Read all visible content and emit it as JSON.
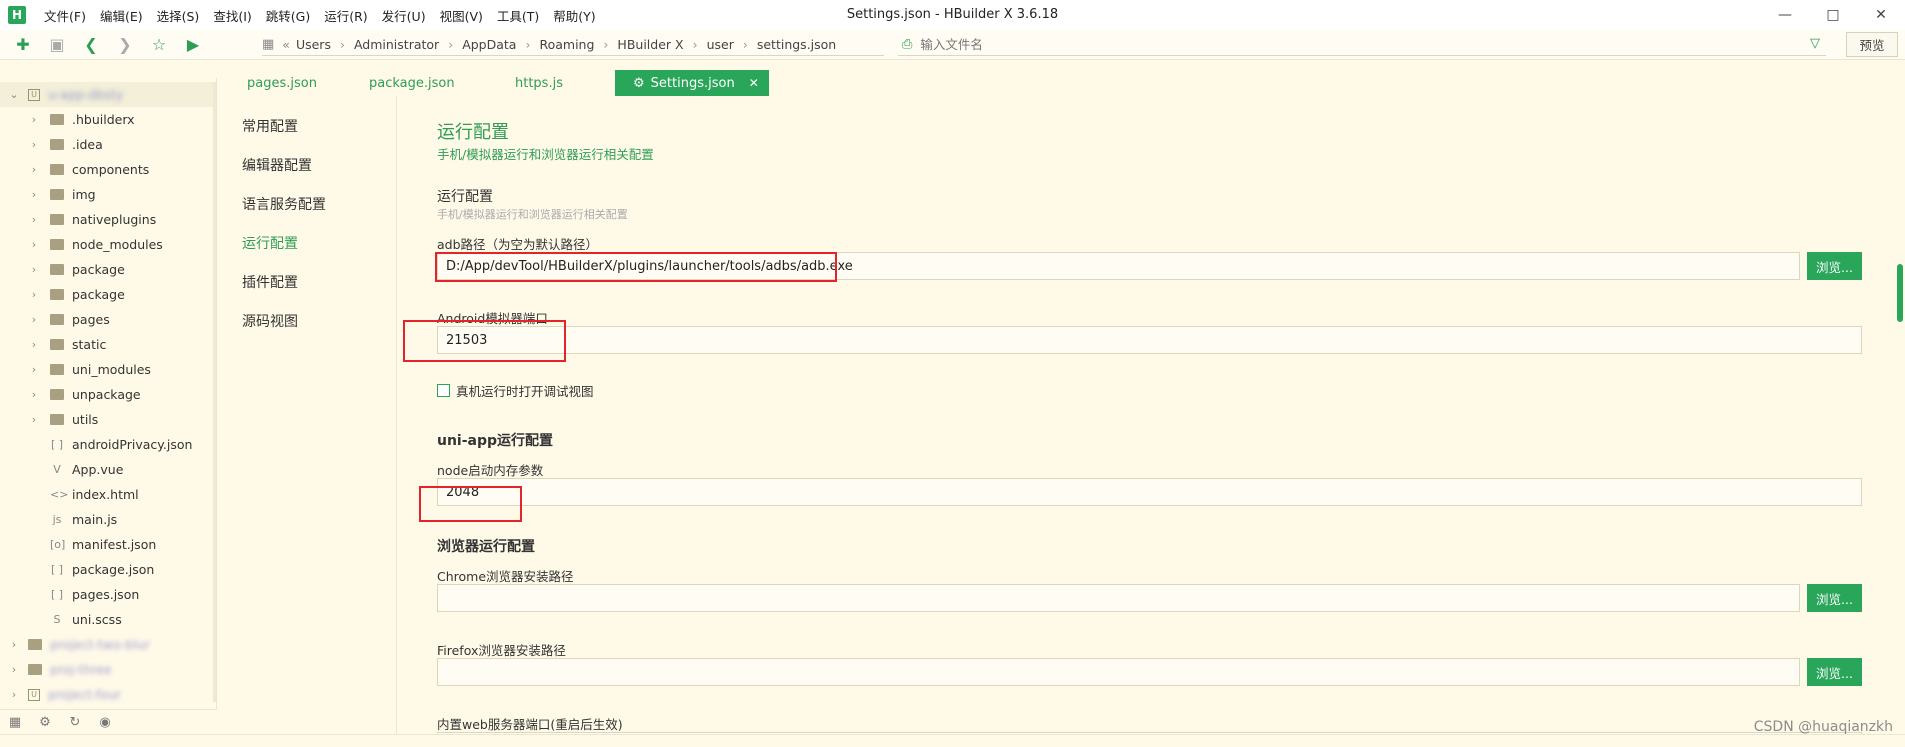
{
  "app": {
    "logo": "H",
    "window_title": "Settings.json - HBuilder X 3.6.18"
  },
  "menu": [
    "文件(F)",
    "编辑(E)",
    "选择(S)",
    "查找(I)",
    "跳转(G)",
    "运行(R)",
    "发行(U)",
    "视图(V)",
    "工具(T)",
    "帮助(Y)"
  ],
  "toolbar": {
    "breadcrumb_prefix": "«",
    "breadcrumb": [
      "Users",
      "Administrator",
      "AppData",
      "Roaming",
      "HBuilder X",
      "user",
      "settings.json"
    ],
    "file_search_placeholder": "输入文件名",
    "preview_label": "预览"
  },
  "sidebar": {
    "project_name": "u-app-dbsty",
    "items": [
      {
        "type": "folder",
        "label": ".hbuilderx"
      },
      {
        "type": "folder",
        "label": ".idea"
      },
      {
        "type": "folder",
        "label": "components"
      },
      {
        "type": "folder",
        "label": "img"
      },
      {
        "type": "folder",
        "label": "nativeplugins"
      },
      {
        "type": "folder",
        "label": "node_modules"
      },
      {
        "type": "folder",
        "label": "package"
      },
      {
        "type": "folder",
        "label": "package"
      },
      {
        "type": "folder",
        "label": "pages"
      },
      {
        "type": "folder",
        "label": "static"
      },
      {
        "type": "folder",
        "label": "uni_modules"
      },
      {
        "type": "folder",
        "label": "unpackage"
      },
      {
        "type": "folder",
        "label": "utils"
      },
      {
        "type": "file",
        "icon": "[ ]",
        "label": "androidPrivacy.json"
      },
      {
        "type": "file",
        "icon": "V",
        "label": "App.vue"
      },
      {
        "type": "file",
        "icon": "<>",
        "label": "index.html"
      },
      {
        "type": "file",
        "icon": "js",
        "label": "main.js"
      },
      {
        "type": "file",
        "icon": "[o]",
        "label": "manifest.json"
      },
      {
        "type": "file",
        "icon": "[ ]",
        "label": "package.json"
      },
      {
        "type": "file",
        "icon": "[ ]",
        "label": "pages.json"
      },
      {
        "type": "file",
        "icon": "S",
        "label": "uni.scss"
      }
    ],
    "other_projects": [
      "project-two-blur",
      "proj-three",
      "project-four"
    ]
  },
  "tabs": [
    {
      "label": "pages.json",
      "active": false
    },
    {
      "label": "package.json",
      "active": false
    },
    {
      "label": "https.js",
      "active": false
    },
    {
      "label": "Settings.json",
      "active": true
    }
  ],
  "settings_nav": [
    "常用配置",
    "编辑器配置",
    "语言服务配置",
    "运行配置",
    "插件配置",
    "源码视图"
  ],
  "settings_nav_active": "运行配置",
  "content": {
    "title": "运行配置",
    "subtitle": "手机/模拟器运行和浏览器运行相关配置",
    "run_section": {
      "title": "运行配置",
      "desc": "手机/模拟器运行和浏览器运行相关配置",
      "adb_label": "adb路径（为空为默认路径）",
      "adb_value": "D:/App/devTool/HBuilderX/plugins/launcher/tools/adbs/adb.exe",
      "android_port_label": "Android模拟器端口",
      "android_port_value": "21503",
      "debug_view_label": "真机运行时打开调试视图"
    },
    "uniapp_section": {
      "title": "uni-app运行配置",
      "node_mem_label": "node启动内存参数",
      "node_mem_value": "2048"
    },
    "browser_section": {
      "title": "浏览器运行配置",
      "chrome_label": "Chrome浏览器安装路径",
      "chrome_value": "",
      "firefox_label": "Firefox浏览器安装路径",
      "firefox_value": "",
      "web_port_label": "内置web服务器端口(重启后生效)"
    },
    "browse_label": "浏览..."
  },
  "watermark": "CSDN @huaqianzkh",
  "colors": {
    "accent": "#2aa65a",
    "background": "#fffae8",
    "highlight": "#e4242a"
  }
}
